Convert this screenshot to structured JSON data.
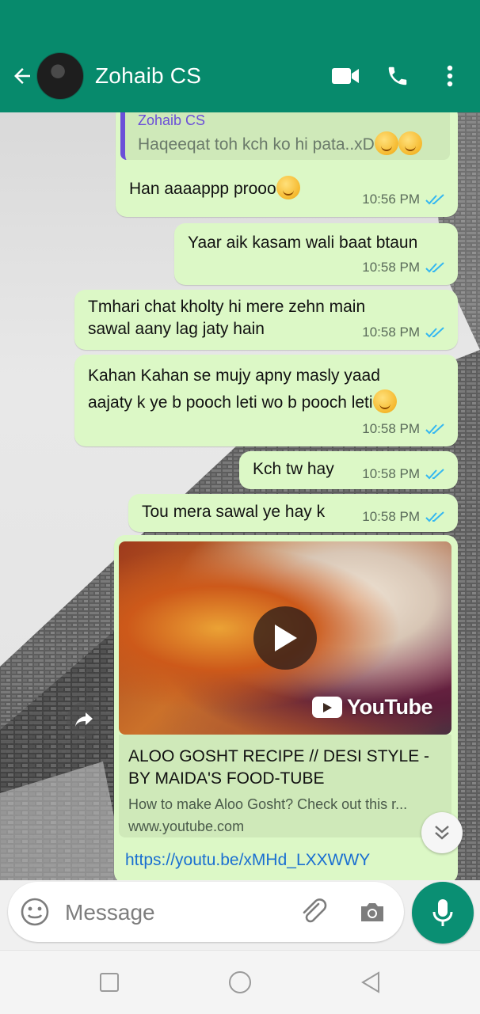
{
  "header": {
    "contact_name": "Zohaib CS",
    "icons": [
      "back-arrow-icon",
      "video-call-icon",
      "phone-icon",
      "more-options-icon"
    ]
  },
  "messages": [
    {
      "type": "text",
      "quote": {
        "author": "Zohaib CS",
        "text": "Haqeeqat toh kch ko hi pata..xD"
      },
      "text": "Han aaaappp prooo",
      "time": "10:56 PM"
    },
    {
      "type": "text",
      "text": "Yaar aik kasam wali baat btaun",
      "time": "10:58 PM"
    },
    {
      "type": "text",
      "line1": "Tmhari chat kholty hi mere zehn main",
      "line2": "sawal aany lag jaty hain",
      "time": "10:58 PM"
    },
    {
      "type": "text",
      "line1": "Kahan Kahan se mujy apny masly yaad",
      "line2": "aajaty k ye b pooch leti wo b pooch leti",
      "time": "10:58 PM"
    },
    {
      "type": "text",
      "text": "Kch tw hay",
      "time": "10:58 PM"
    },
    {
      "type": "text",
      "text": "Tou mera sawal ye hay k",
      "time": "10:58 PM"
    },
    {
      "type": "link",
      "preview_title": "ALOO GOSHT RECIPE // DESI STYLE - BY MAIDA'S FOOD-TUBE",
      "preview_desc": "How to make Aloo Gosht? Check out this r...",
      "preview_domain": "www.youtube.com",
      "brand": "YouTube",
      "url": "https://youtu.be/xMHd_LXXWWY"
    }
  ],
  "composer": {
    "placeholder": "Message",
    "icons": [
      "emoji-icon",
      "attach-icon",
      "camera-icon",
      "mic-icon"
    ]
  },
  "colors": {
    "header": "#078a6c",
    "bubble": "#dcf8c6",
    "read_ticks": "#34b7f1",
    "link": "#1a6fd1"
  }
}
